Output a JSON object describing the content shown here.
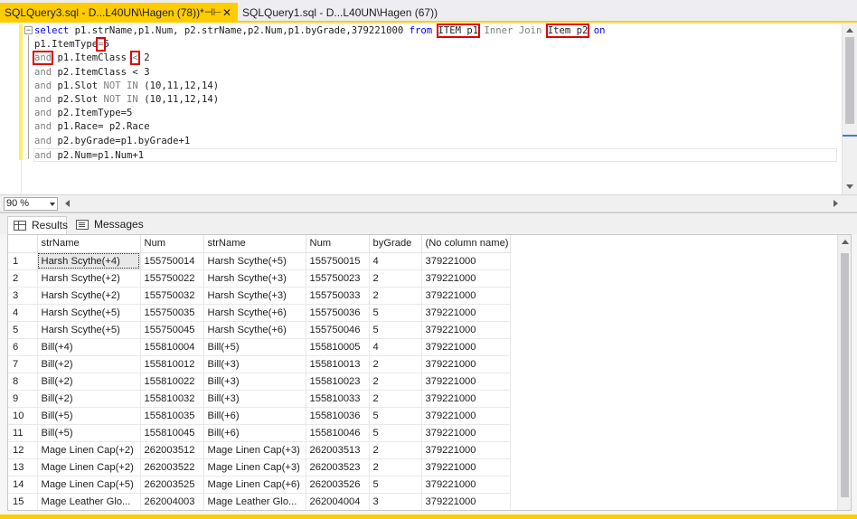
{
  "tabs": [
    {
      "label": "SQLQuery3.sql - D...L40UN\\Hagen (78))*",
      "pin": "⊣⊢",
      "close": "✕"
    },
    {
      "label": "SQLQuery1.sql - D...L40UN\\Hagen (67))"
    }
  ],
  "sql": {
    "line1": {
      "select": "select",
      "cols": " p1.strName,p1.Num, p2.strName,p2.Num,p1.byGrade,379221000 ",
      "from": "from",
      "sp1": " ",
      "t1": "ITEM p1",
      "sp2": " ",
      "join": "Inner Join",
      "sp3": " ",
      "t2": "Item p2",
      "sp4": " ",
      "on": "on"
    },
    "line2": {
      "text": "p1.ItemType",
      "op": "=",
      "tail": "5"
    },
    "line3": {
      "and": "and",
      "text": " p1.ItemClass ",
      "op": "<",
      "tail": " 2"
    },
    "lines": [
      {
        "and": "and",
        "text": " p2.ItemClass < 3"
      },
      {
        "and": "and",
        "text": " p1.Slot ",
        "notin": "NOT IN",
        "rest": " (10,11,12,14)"
      },
      {
        "and": "and",
        "text": " p2.Slot ",
        "notin": "NOT IN",
        "rest": " (10,11,12,14)"
      },
      {
        "and": "and",
        "text": " p2.ItemType=5"
      },
      {
        "and": "and",
        "text": " p1.Race= p2.Race"
      },
      {
        "and": "and",
        "text": " p2.byGrade=p1.byGrade+1"
      },
      {
        "and": "and",
        "text": " p2.Num=p1.Num+1"
      }
    ]
  },
  "zoom": {
    "value": "90 %"
  },
  "result_tabs": {
    "results": "Results",
    "messages": "Messages"
  },
  "grid": {
    "columns": [
      "",
      "strName",
      "Num",
      "strName",
      "Num",
      "byGrade",
      "(No column name)"
    ],
    "rows": [
      [
        "1",
        "Harsh Scythe(+4)",
        "155750014",
        "Harsh Scythe(+5)",
        "155750015",
        "4",
        "379221000"
      ],
      [
        "2",
        "Harsh Scythe(+2)",
        "155750022",
        "Harsh Scythe(+3)",
        "155750023",
        "2",
        "379221000"
      ],
      [
        "3",
        "Harsh Scythe(+2)",
        "155750032",
        "Harsh Scythe(+3)",
        "155750033",
        "2",
        "379221000"
      ],
      [
        "4",
        "Harsh Scythe(+5)",
        "155750035",
        "Harsh Scythe(+6)",
        "155750036",
        "5",
        "379221000"
      ],
      [
        "5",
        "Harsh Scythe(+5)",
        "155750045",
        "Harsh Scythe(+6)",
        "155750046",
        "5",
        "379221000"
      ],
      [
        "6",
        "Bill(+4)",
        "155810004",
        "Bill(+5)",
        "155810005",
        "4",
        "379221000"
      ],
      [
        "7",
        "Bill(+2)",
        "155810012",
        "Bill(+3)",
        "155810013",
        "2",
        "379221000"
      ],
      [
        "8",
        "Bill(+2)",
        "155810022",
        "Bill(+3)",
        "155810023",
        "2",
        "379221000"
      ],
      [
        "9",
        "Bill(+2)",
        "155810032",
        "Bill(+3)",
        "155810033",
        "2",
        "379221000"
      ],
      [
        "10",
        "Bill(+5)",
        "155810035",
        "Bill(+6)",
        "155810036",
        "5",
        "379221000"
      ],
      [
        "11",
        "Bill(+5)",
        "155810045",
        "Bill(+6)",
        "155810046",
        "5",
        "379221000"
      ],
      [
        "12",
        "Mage Linen Cap(+2)",
        "262003512",
        "Mage Linen Cap(+3)",
        "262003513",
        "2",
        "379221000"
      ],
      [
        "13",
        "Mage Linen Cap(+2)",
        "262003522",
        "Mage Linen Cap(+3)",
        "262003523",
        "2",
        "379221000"
      ],
      [
        "14",
        "Mage Linen Cap(+5)",
        "262003525",
        "Mage Linen Cap(+6)",
        "262003526",
        "5",
        "379221000"
      ],
      [
        "15",
        "Mage Leather Glo...",
        "262004003",
        "Mage Leather Glo...",
        "262004004",
        "3",
        "379221000"
      ]
    ]
  }
}
